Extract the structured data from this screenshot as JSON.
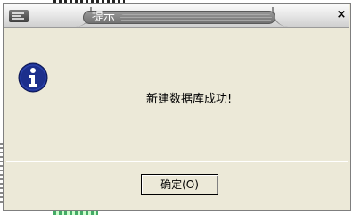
{
  "dialog": {
    "title": "提示",
    "close_glyph": "×",
    "message": "新建数据库成功!",
    "ok_label": "确定(O)",
    "icon": "info-icon"
  },
  "colors": {
    "dialog_bg": "#ece9d8",
    "info_icon_bg": "#1c2f8c",
    "title_pill": "#7a7a7a"
  }
}
